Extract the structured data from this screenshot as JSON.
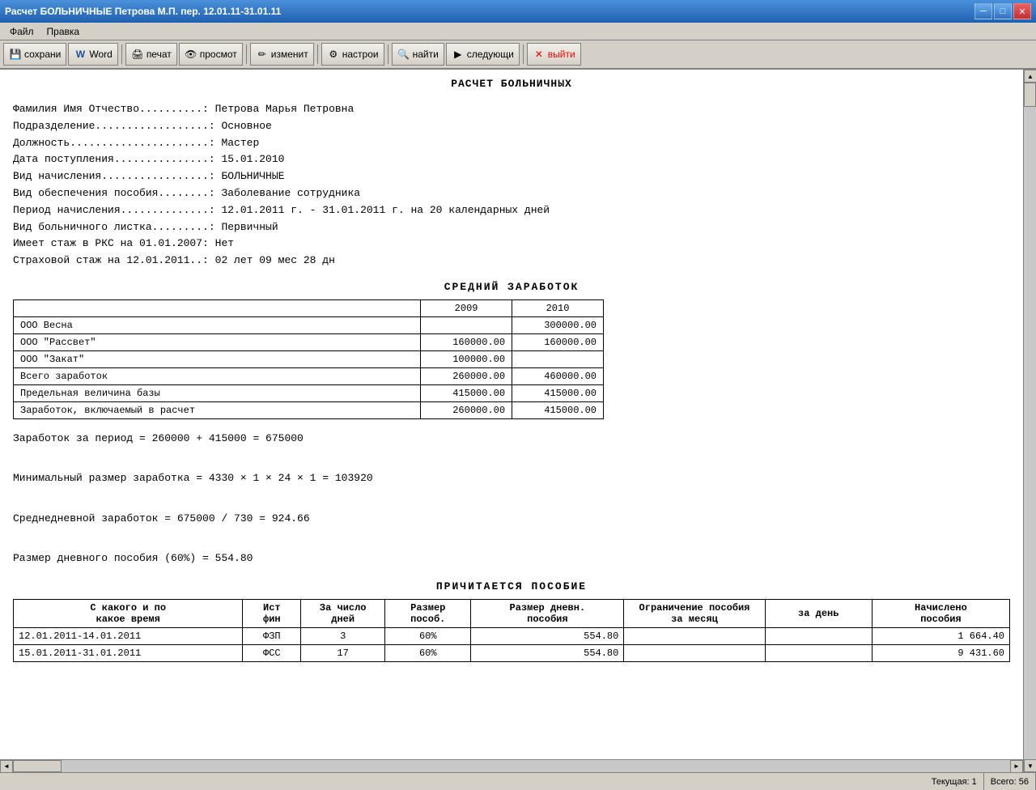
{
  "titlebar": {
    "text": "Расчет БОЛЬНИЧНЫЕ Петрова М.П. пер. 12.01.11-31.01.11",
    "min": "─",
    "max": "□",
    "close": "✕"
  },
  "menubar": {
    "items": [
      "Файл",
      "Правка"
    ]
  },
  "toolbar": {
    "buttons": [
      {
        "id": "save",
        "label": "сохрани",
        "icon": "💾"
      },
      {
        "id": "word",
        "label": "Word",
        "icon": "W"
      },
      {
        "id": "print",
        "label": "печат",
        "icon": "🖨"
      },
      {
        "id": "preview",
        "label": "просмот",
        "icon": "👁"
      },
      {
        "id": "edit",
        "label": "изменит",
        "icon": "✏"
      },
      {
        "id": "settings",
        "label": "настрои",
        "icon": "⚙"
      },
      {
        "id": "find",
        "label": "найти",
        "icon": "🔍"
      },
      {
        "id": "next",
        "label": "следующи",
        "icon": "▶"
      },
      {
        "id": "exit",
        "label": "выйти",
        "icon": "✕"
      }
    ]
  },
  "document": {
    "title": "РАСЧЕТ БОЛЬНИЧНЫХ",
    "fields": [
      {
        "label": "Фамилия Имя Отчество..........",
        "value": "Петрова Марья Петровна"
      },
      {
        "label": "Подразделение..................",
        "value": "Основное"
      },
      {
        "label": "Должность......................",
        "value": "Мастер"
      },
      {
        "label": "Дата поступления...............",
        "value": "15.01.2010"
      },
      {
        "label": "Вид начисления.................",
        "value": "БОЛЬНИЧНЫЕ"
      },
      {
        "label": "Вид обеспечения пособия........",
        "value": "Заболевание сотрудника"
      },
      {
        "label": "Период начисления..............",
        "value": "12.01.2011 г. - 31.01.2011 г. на 20 календарных дней"
      },
      {
        "label": "Вид больничного листка.........",
        "value": "Первичный"
      },
      {
        "label": "Имеет стаж в РКС на 01.01.2007",
        "value": "Нет"
      },
      {
        "label": "Страховой стаж на 12.01.2011..",
        "value": "02 лет 09 мес 28 дн"
      }
    ],
    "section_avg": "СРЕДНИЙ   ЗАРАБОТОК",
    "table_avg": {
      "headers": [
        "",
        "2009",
        "2010"
      ],
      "rows": [
        {
          "label": "ООО Весна",
          "v2009": "",
          "v2010": "300000.00"
        },
        {
          "label": "ООО \"Рассвет\"",
          "v2009": "160000.00",
          "v2010": "160000.00"
        },
        {
          "label": "ООО \"Закат\"",
          "v2009": "100000.00",
          "v2010": ""
        },
        {
          "label": "Всего заработок",
          "v2009": "260000.00",
          "v2010": "460000.00"
        },
        {
          "label": "Предельная величина базы",
          "v2009": "415000.00",
          "v2010": "415000.00"
        },
        {
          "label": "Заработок, включаемый в расчет",
          "v2009": "260000.00",
          "v2010": "415000.00"
        }
      ]
    },
    "calc_lines": [
      "Заработок за период = 260000 + 415000 = 675000",
      "Минимальный размер заработка = 4330 × 1 × 24 × 1 = 103920",
      "Среднедневной заработок    = 675000 / 730 = 924.66",
      "Размер дневного пособия (60%) = 554.80"
    ],
    "section_benefits": "ПРИЧИТАЕТСЯ ПОСОБИЕ",
    "benefits_table": {
      "headers": [
        {
          "text": "С какого и по\nкакое время",
          "width": "140"
        },
        {
          "text": "Ист\nфин",
          "width": "35"
        },
        {
          "text": "За число\nдней",
          "width": "55"
        },
        {
          "text": "Размер\nпособ.",
          "width": "55"
        },
        {
          "text": "Размер дневн.\nпособия",
          "width": "90"
        },
        {
          "text": "Ограничение пособия\nза месяц",
          "width": "90"
        },
        {
          "text": "за день",
          "width": "70"
        },
        {
          "text": "Начислено\nпособия",
          "width": "90"
        }
      ],
      "rows": [
        {
          "period": "12.01.2011-14.01.2011",
          "source": "ФЗП",
          "days": "3",
          "size_pct": "60%",
          "daily_benefit": "554.80",
          "limit_month": "",
          "limit_day": "",
          "accrued": "1 664.40"
        },
        {
          "period": "15.01.2011-31.01.2011",
          "source": "ФСС",
          "days": "17",
          "size_pct": "60%",
          "daily_benefit": "554.80",
          "limit_month": "",
          "limit_day": "",
          "accrued": "9 431.60"
        }
      ]
    }
  },
  "statusbar": {
    "current_label": "Текущая:",
    "current_value": "1",
    "total_label": "Всего:",
    "total_value": "56"
  }
}
